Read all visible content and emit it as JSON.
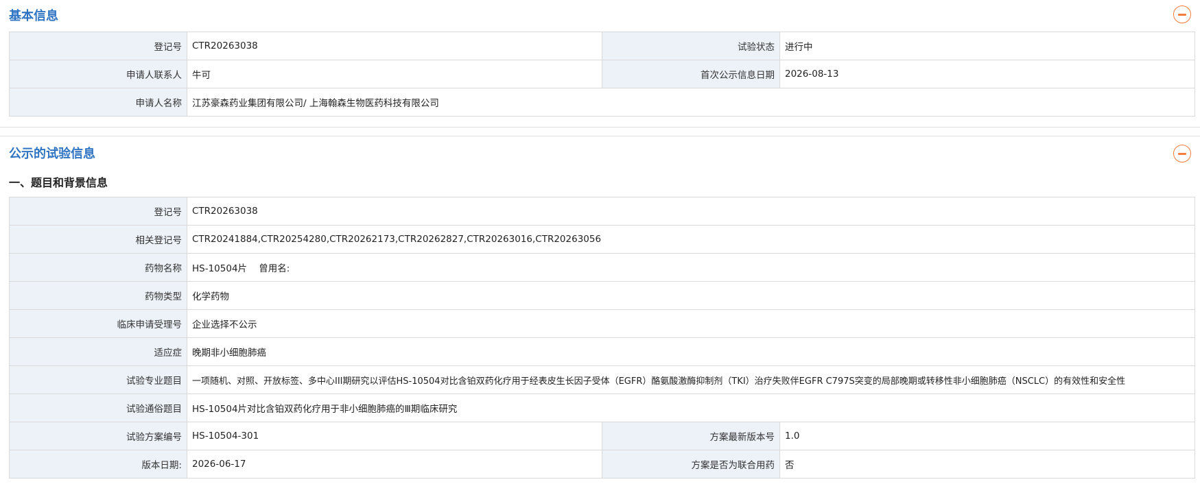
{
  "basic_info": {
    "title": "基本信息",
    "rows": [
      {
        "label1": "登记号",
        "value1": "CTR20263038",
        "label2": "试验状态",
        "value2": "进行中"
      },
      {
        "label1": "申请人联系人",
        "value1": "牛可",
        "label2": "首次公示信息日期",
        "value2": "2026-08-13"
      },
      {
        "label1": "申请人名称",
        "value1": "江苏豪森药业集团有限公司/ 上海翰森生物医药科技有限公司"
      }
    ]
  },
  "trial_info": {
    "title": "公示的试验信息",
    "section_title": "一、题目和背景信息",
    "rows": [
      {
        "label": "登记号",
        "value": "CTR20263038"
      },
      {
        "label": "相关登记号",
        "value": "CTR20241884,CTR20254280,CTR20262173,CTR20262827,CTR20263016,CTR20263056"
      },
      {
        "label": "药物名称",
        "value": "HS-10504片    曾用名:"
      },
      {
        "label": "药物类型",
        "value": "化学药物"
      },
      {
        "label": "临床申请受理号",
        "value": "企业选择不公示"
      },
      {
        "label": "适应症",
        "value": "晚期非小细胞肺癌"
      },
      {
        "label": "试验专业题目",
        "value": "一项随机、对照、开放标签、多中心III期研究以评估HS-10504对比含铂双药化疗用于经表皮生长因子受体（EGFR）酪氨酸激酶抑制剂（TKI）治疗失败伴EGFR C797S突变的局部晚期或转移性非小细胞肺癌（NSCLC）的有效性和安全性"
      },
      {
        "label": "试验通俗题目",
        "value": "HS-10504片对比含铂双药化疗用于非小细胞肺癌的Ⅲ期临床研究"
      }
    ],
    "split_rows": [
      {
        "label1": "试验方案编号",
        "value1": "HS-10504-301",
        "label2": "方案最新版本号",
        "value2": "1.0"
      },
      {
        "label1": "版本日期:",
        "value1": "2026-06-17",
        "label2": "方案是否为联合用药",
        "value2": "否"
      }
    ]
  },
  "colors": {
    "title": "#2f74c2",
    "label_bg": "#edf1f8",
    "collapse": "#f47c3c",
    "border": "#d9d9d9"
  },
  "icons": {
    "collapse": "minus-circle-icon"
  }
}
